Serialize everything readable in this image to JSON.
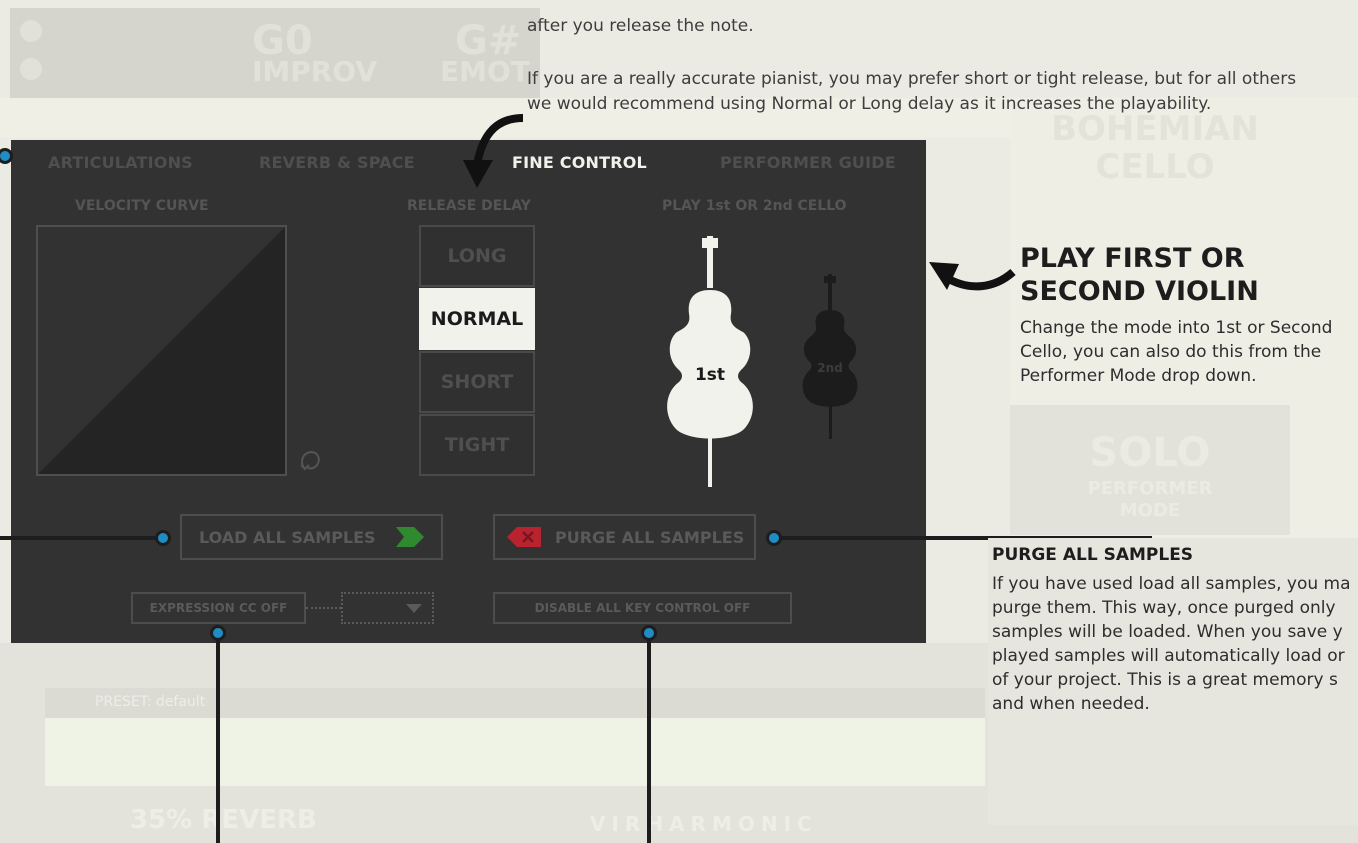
{
  "background": {
    "note_primary": "G0",
    "mode_primary": "IMPROV",
    "note_secondary": "G#",
    "mode_secondary": "EMOT",
    "instrument_line1": "BOHEMIAN",
    "instrument_line2": "CELLO",
    "mode_big": "SOLO",
    "mode_small1": "PERFORMER",
    "mode_small2": "MODE",
    "preset_label": "PRESET: default",
    "reverb_label": "35% REVERB",
    "brand": "VIRHARMONIC"
  },
  "intro": {
    "line1": "after you release the note.",
    "line2": "If you are a really accurate pianist, you may prefer short or tight release, but for all others",
    "line3": "we would recommend using Normal or Long delay as it increases the playability."
  },
  "tabs": [
    {
      "label": "ARTICULATIONS"
    },
    {
      "label": "REVERB & SPACE"
    },
    {
      "label": "FINE CONTROL"
    },
    {
      "label": "PERFORMER GUIDE"
    }
  ],
  "sections": {
    "velocity": "VELOCITY CURVE",
    "release": "RELEASE DELAY",
    "cello": "PLAY 1st OR 2nd CELLO"
  },
  "release_options": [
    {
      "label": "LONG"
    },
    {
      "label": "NORMAL"
    },
    {
      "label": "SHORT"
    },
    {
      "label": "TIGHT"
    }
  ],
  "selected_release": "NORMAL",
  "cello": {
    "first": "1st",
    "second": "2nd"
  },
  "buttons": {
    "load_all": "LOAD ALL SAMPLES",
    "purge_all": "PURGE ALL SAMPLES",
    "expression_cc": "EXPRESSION CC OFF",
    "disable_keys": "DISABLE ALL KEY CONTROL OFF"
  },
  "annotation_violin": {
    "title_line1": "PLAY FIRST OR",
    "title_line2": "SECOND VIOLIN",
    "line1": "Change the mode into 1st or Second",
    "line2": "Cello, you can also do this from the",
    "line3": "Performer Mode drop down."
  },
  "annotation_purge": {
    "title": "PURGE ALL SAMPLES",
    "line1": "If you have used load all samples, you ma",
    "line2": "purge them. This way, once purged only",
    "line3": "samples will be loaded. When you save y",
    "line4": "played samples will automatically load or",
    "line5": "of your project. This is a great memory s",
    "line6": "and when needed."
  },
  "colors": {
    "panel": "#323232",
    "accent_dot": "#1f8cc3",
    "load_icon": "#2f8a2f",
    "purge_icon": "#b8232f"
  }
}
